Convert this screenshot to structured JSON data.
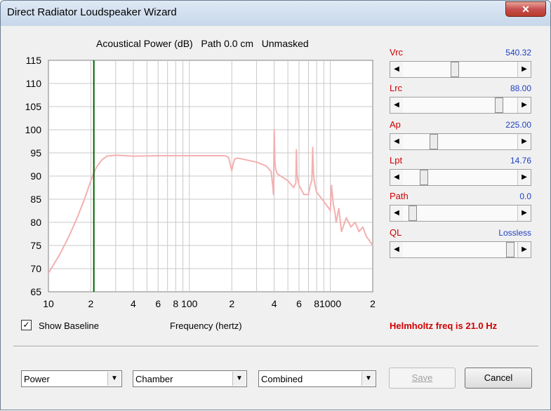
{
  "window": {
    "title": "Direct Radiator Loudspeaker Wizard",
    "close_glyph": "✕"
  },
  "chart_header": "Acoustical Power (dB)   Path 0.0 cm   Unmasked",
  "chart_data": {
    "type": "line",
    "title": "Acoustical Power (dB)   Path 0.0 cm   Unmasked",
    "xlabel": "Frequency (hertz)",
    "ylabel": "",
    "x_scale": "log",
    "xlim": [
      10,
      2000
    ],
    "ylim": [
      65,
      115
    ],
    "y_ticks": [
      "115",
      "110",
      "105",
      "100",
      "95",
      "90",
      "85",
      "80",
      "75",
      "70",
      "65"
    ],
    "x_ticks": [
      {
        "value": 10,
        "label": "10"
      },
      {
        "value": 20,
        "label": "2"
      },
      {
        "value": 40,
        "label": "4"
      },
      {
        "value": 60,
        "label": "6"
      },
      {
        "value": 80,
        "label": "8"
      },
      {
        "value": 100,
        "label": "100"
      },
      {
        "value": 200,
        "label": "2"
      },
      {
        "value": 400,
        "label": "4"
      },
      {
        "value": 600,
        "label": "6"
      },
      {
        "value": 800,
        "label": "8"
      },
      {
        "value": 1000,
        "label": "1000"
      },
      {
        "value": 2000,
        "label": "2"
      }
    ],
    "marker_x": 21,
    "marker_color": "#006400",
    "line_color": "#f4b0b0",
    "series": [
      {
        "x": [
          10,
          12,
          14,
          16,
          18,
          20,
          21,
          22,
          24,
          26,
          30,
          40,
          60,
          100,
          150,
          180,
          190,
          195,
          200,
          205,
          210,
          220,
          300,
          350,
          380,
          390,
          395,
          400,
          405,
          410,
          420,
          500,
          550,
          570,
          575,
          580,
          590,
          600,
          650,
          700,
          720,
          740,
          750,
          760,
          770,
          780,
          800,
          850,
          900,
          950,
          980,
          1000,
          1020,
          1050,
          1080,
          1100,
          1150,
          1200,
          1300,
          1400,
          1500,
          1600,
          1700,
          1800,
          1900,
          1950,
          2000
        ],
        "y": [
          69,
          73,
          77,
          81,
          85,
          89,
          90.7,
          92,
          93.5,
          94.3,
          94.5,
          94.3,
          94.4,
          94.4,
          94.4,
          94.4,
          94.0,
          92.5,
          91.2,
          92.7,
          93.7,
          93.9,
          93.0,
          92.2,
          91.0,
          88.0,
          86.0,
          100.0,
          93.0,
          91.5,
          90.5,
          89.0,
          87.5,
          88.5,
          95.7,
          90.5,
          89.0,
          88.0,
          86.0,
          86.0,
          88.0,
          89.0,
          96.2,
          90.5,
          89.0,
          88.0,
          86.5,
          85.5,
          84.5,
          83.5,
          83.0,
          82.5,
          88.0,
          84.0,
          82.0,
          80.0,
          83.0,
          78.0,
          81.0,
          79.0,
          80.0,
          78.0,
          79.0,
          77.0,
          76.0,
          75.5,
          75.0
        ]
      }
    ]
  },
  "controls": [
    {
      "label": "Vrc",
      "value": "540.32",
      "position": 0.45
    },
    {
      "label": "Lrc",
      "value": "88.00",
      "position": 0.86
    },
    {
      "label": "Ap",
      "value": "225.00",
      "position": 0.25
    },
    {
      "label": "Lpt",
      "value": "14.76",
      "position": 0.16
    },
    {
      "label": "Path",
      "value": "0.0",
      "position": 0.05
    },
    {
      "label": "QL",
      "value": "Lossless",
      "position": 0.97
    }
  ],
  "show_baseline": {
    "label": "Show Baseline",
    "checked_glyph": "✓"
  },
  "frequency_label": "Frequency (hertz)",
  "helmholtz_text": "Helmholtz freq is 21.0 Hz",
  "dropdowns": {
    "plot": "Power",
    "environment": "Chamber",
    "component": "Combined"
  },
  "buttons": {
    "save": "Save",
    "cancel": "Cancel"
  }
}
